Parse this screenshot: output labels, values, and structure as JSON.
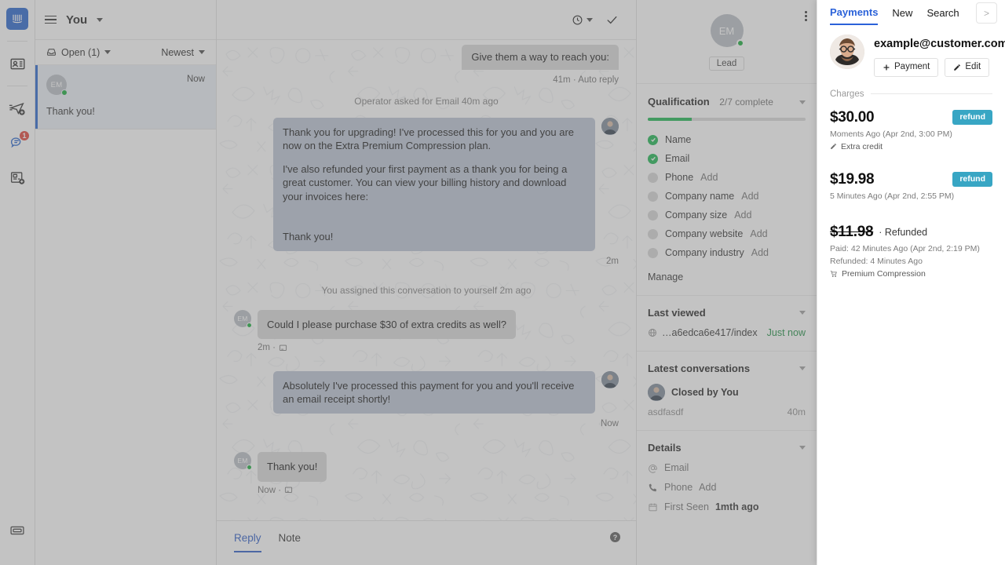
{
  "rail": {
    "items": [
      {
        "name": "intercom-logo",
        "label": ""
      },
      {
        "name": "contacts-icon",
        "label": ""
      },
      {
        "name": "send-outbound-icon",
        "label": ""
      },
      {
        "name": "conversations-icon",
        "label": "",
        "badge": "1"
      },
      {
        "name": "articles-icon",
        "label": ""
      },
      {
        "name": "inbox-icon",
        "label": ""
      }
    ]
  },
  "conversation_list": {
    "header_title": "You",
    "filter_left": "Open (1)",
    "filter_right": "Newest",
    "items": [
      {
        "initials": "EM",
        "time": "Now",
        "snippet": "Thank you!"
      }
    ]
  },
  "conversation": {
    "toolbar": {
      "snooze_icon": "clock-icon",
      "close_icon": "check-icon"
    },
    "messages": [
      {
        "type": "partial-out",
        "text": "Give them a way to reach you:",
        "meta": "41m · Auto reply"
      },
      {
        "type": "system",
        "text": "Operator asked for Email 40m ago"
      },
      {
        "type": "out",
        "paragraphs": [
          "Thank you for upgrading! I've processed this for you and you are now on the Extra Premium Compression plan.",
          "I've also refunded your first payment as a thank you for being a great customer. You can view your billing history and download your invoices here:",
          "",
          "Thank you!"
        ],
        "meta": "2m"
      },
      {
        "type": "system",
        "text": "You assigned this conversation to yourself 2m ago"
      },
      {
        "type": "in",
        "initials": "EM",
        "text": "Could I please purchase $30 of extra credits as well?",
        "meta": "2m ·"
      },
      {
        "type": "out",
        "paragraphs": [
          "Absolutely I've processed this payment for you and you'll receive an email receipt shortly!"
        ],
        "meta": "Now"
      },
      {
        "type": "in",
        "initials": "EM",
        "text": "Thank you!",
        "meta": "Now ·"
      }
    ],
    "composer": {
      "tabs": [
        "Reply",
        "Note"
      ],
      "active_tab": "Reply",
      "help": "?"
    }
  },
  "details": {
    "avatar_initials": "EM",
    "lead_tag": "Lead",
    "qualification": {
      "title": "Qualification",
      "subtitle": "2/7 complete",
      "progress_percent": 28,
      "items": [
        {
          "label": "Name",
          "done": true,
          "action": ""
        },
        {
          "label": "Email",
          "done": true,
          "action": ""
        },
        {
          "label": "Phone",
          "done": false,
          "action": "Add"
        },
        {
          "label": "Company name",
          "done": false,
          "action": "Add"
        },
        {
          "label": "Company size",
          "done": false,
          "action": "Add"
        },
        {
          "label": "Company website",
          "done": false,
          "action": "Add"
        },
        {
          "label": "Company industry",
          "done": false,
          "action": "Add"
        }
      ],
      "manage": "Manage"
    },
    "last_viewed": {
      "title": "Last viewed",
      "url": "…a6edca6e417/index",
      "time": "Just now"
    },
    "latest_conversations": {
      "title": "Latest conversations",
      "status": "Closed by You",
      "preview": "asdfasdf",
      "time": "40m"
    },
    "details_section": {
      "title": "Details",
      "rows": [
        {
          "icon": "at-icon",
          "label": "Email",
          "value": ""
        },
        {
          "icon": "phone-icon",
          "label": "Phone",
          "value": "Add"
        },
        {
          "icon": "calendar-icon",
          "label": "First Seen",
          "value": "1mth ago"
        }
      ]
    }
  },
  "payments": {
    "tabs": [
      {
        "label": "Payments",
        "active": true
      },
      {
        "label": "New",
        "active": false
      },
      {
        "label": "Search",
        "active": false
      }
    ],
    "expand_label": ">",
    "email": "example@customer.com",
    "buttons": [
      {
        "label": "Payment",
        "icon": "plus-icon"
      },
      {
        "label": "Edit",
        "icon": "pencil-icon"
      }
    ],
    "charges_label": "Charges",
    "charges": [
      {
        "amount": "$30.00",
        "struck": false,
        "status": "",
        "badge": "refund",
        "meta": [
          "Moments Ago (Apr 2nd, 3:00 PM)"
        ],
        "tag": "Extra credit",
        "tag_icon": "pencil-icon"
      },
      {
        "amount": "$19.98",
        "struck": false,
        "status": "",
        "badge": "refund",
        "meta": [
          "5 Minutes Ago (Apr 2nd, 2:55 PM)"
        ],
        "tag": "",
        "tag_icon": ""
      },
      {
        "amount": "$11.98",
        "struck": true,
        "status": "· Refunded",
        "badge": "",
        "meta": [
          "Paid: 42 Minutes Ago (Apr 2nd, 2:19 PM)",
          "Refunded: 4 Minutes Ago"
        ],
        "tag": "Premium Compression",
        "tag_icon": "cart-icon"
      }
    ]
  },
  "colors": {
    "accent_blue": "#2b62d9",
    "refund_teal": "#38a6c4",
    "online_green": "#0ea832",
    "progress_green": "#14b34a",
    "badge_red": "#e03c31"
  }
}
